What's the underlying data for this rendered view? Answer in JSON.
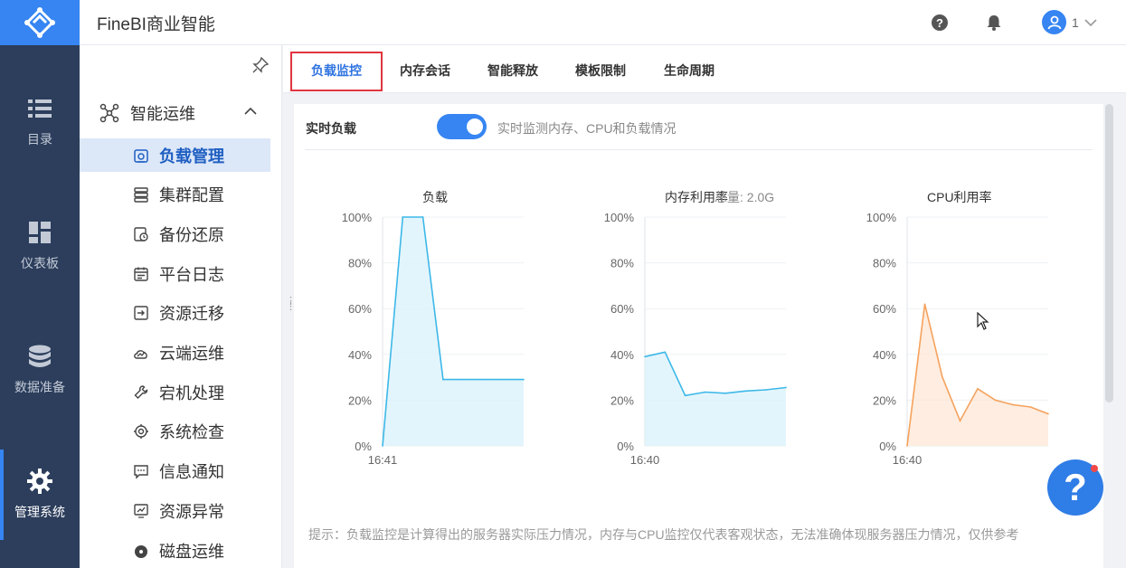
{
  "app": {
    "title": "FineBI商业智能",
    "user_name": "1"
  },
  "rail": [
    {
      "label": "目录",
      "icon": "list-icon"
    },
    {
      "label": "仪表板",
      "icon": "dashboard-icon"
    },
    {
      "label": "数据准备",
      "icon": "database-icon"
    },
    {
      "label": "管理系统",
      "icon": "gear-icon",
      "active": true
    }
  ],
  "subnav": {
    "group_label": "智能运维",
    "items": [
      {
        "label": "负载管理",
        "active": true
      },
      {
        "label": "集群配置"
      },
      {
        "label": "备份还原"
      },
      {
        "label": "平台日志"
      },
      {
        "label": "资源迁移"
      },
      {
        "label": "云端运维"
      },
      {
        "label": "宕机处理"
      },
      {
        "label": "系统检查"
      },
      {
        "label": "信息通知"
      },
      {
        "label": "资源异常"
      },
      {
        "label": "磁盘运维"
      }
    ]
  },
  "tabs": [
    {
      "label": "负载监控",
      "active": true
    },
    {
      "label": "内存会话"
    },
    {
      "label": "智能释放"
    },
    {
      "label": "模板限制"
    },
    {
      "label": "生命周期"
    }
  ],
  "realtime": {
    "label": "实时负载",
    "enabled": true,
    "description": "实时监测内存、CPU和负载情况"
  },
  "memory_total_label": "总量: 2.0G",
  "hint": "提示：负载监控是计算得出的服务器实际压力情况，内存与CPU监控仅代表客观状态，无法准确体现服务器压力情况，仅供参考",
  "chart_data": [
    {
      "type": "area",
      "title": "负载",
      "y_ticks": [
        "100%",
        "80%",
        "60%",
        "40%",
        "20%",
        "0%"
      ],
      "ylim": [
        0,
        100
      ],
      "x_label": "16:41",
      "color": "#3db8e8",
      "fill": "#d9f1fb",
      "values": [
        0,
        100,
        100,
        29,
        29,
        29,
        29,
        29
      ]
    },
    {
      "type": "area",
      "title": "内存利用率",
      "y_ticks": [
        "100%",
        "80%",
        "60%",
        "40%",
        "20%",
        "0%"
      ],
      "ylim": [
        0,
        100
      ],
      "x_label": "16:40",
      "color": "#3db8e8",
      "fill": "#d9f1fb",
      "values": [
        39,
        41,
        22,
        23.5,
        23,
        24,
        24.5,
        25.5
      ]
    },
    {
      "type": "area",
      "title": "CPU利用率",
      "y_ticks": [
        "100%",
        "80%",
        "60%",
        "40%",
        "20%",
        "0%"
      ],
      "ylim": [
        0,
        100
      ],
      "x_label": "16:40",
      "color": "#f5a25d",
      "fill": "#fde7d5",
      "values": [
        0,
        62,
        30,
        11,
        25,
        20,
        18,
        17,
        14
      ]
    }
  ]
}
